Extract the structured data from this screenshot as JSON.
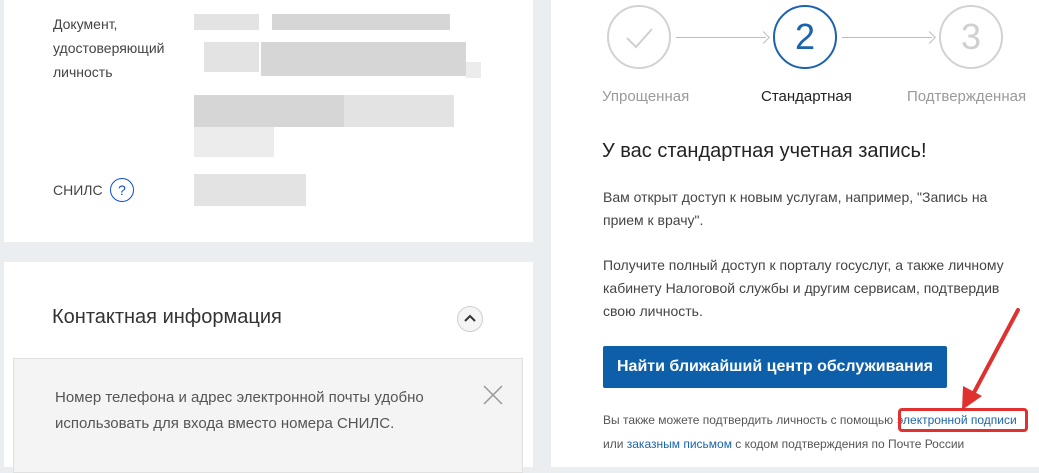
{
  "document_card": {
    "doc_label": "Документ,\nудостоверяющий\nличность",
    "snils_label": "СНИЛС",
    "help_icon": "question-mark"
  },
  "contact_card": {
    "title": "Контактная информация",
    "collapse_icon": "chevron-up-icon",
    "notice_text": "Номер телефона и адрес электронной почты удобно использовать для входа вместо номера СНИЛС.",
    "close_icon": "close-icon"
  },
  "status_card": {
    "steps": [
      {
        "number": "",
        "label": "Упрощенная",
        "state": "done",
        "icon": "checkmark-icon"
      },
      {
        "number": "2",
        "label": "Стандартная",
        "state": "active"
      },
      {
        "number": "3",
        "label": "Подтвержденная",
        "state": "pending"
      }
    ],
    "title": "У вас стандартная учетная запись!",
    "paragraph1": "Вам открыт доступ к новым услугам, например, \"Запись на прием к врачу\".",
    "paragraph2": "Получите полный доступ к порталу госуслуг, а также личному кабинету Налоговой службы и другим сервисам, подтвердив свою личность.",
    "cta_label": "Найти ближайший центр обслуживания",
    "alt_line1_prefix": "Вы также можете подтвердить личность с помощью",
    "alt_link_signature": "электронной подписи",
    "alt_line2_prefix": "или ",
    "alt_link_letter": "заказным письмом",
    "alt_line2_suffix": " с кодом подтверждения по Почте России"
  },
  "colors": {
    "accent": "#1b63ad",
    "button": "#0d5fa9",
    "annotation": "#e03131"
  }
}
